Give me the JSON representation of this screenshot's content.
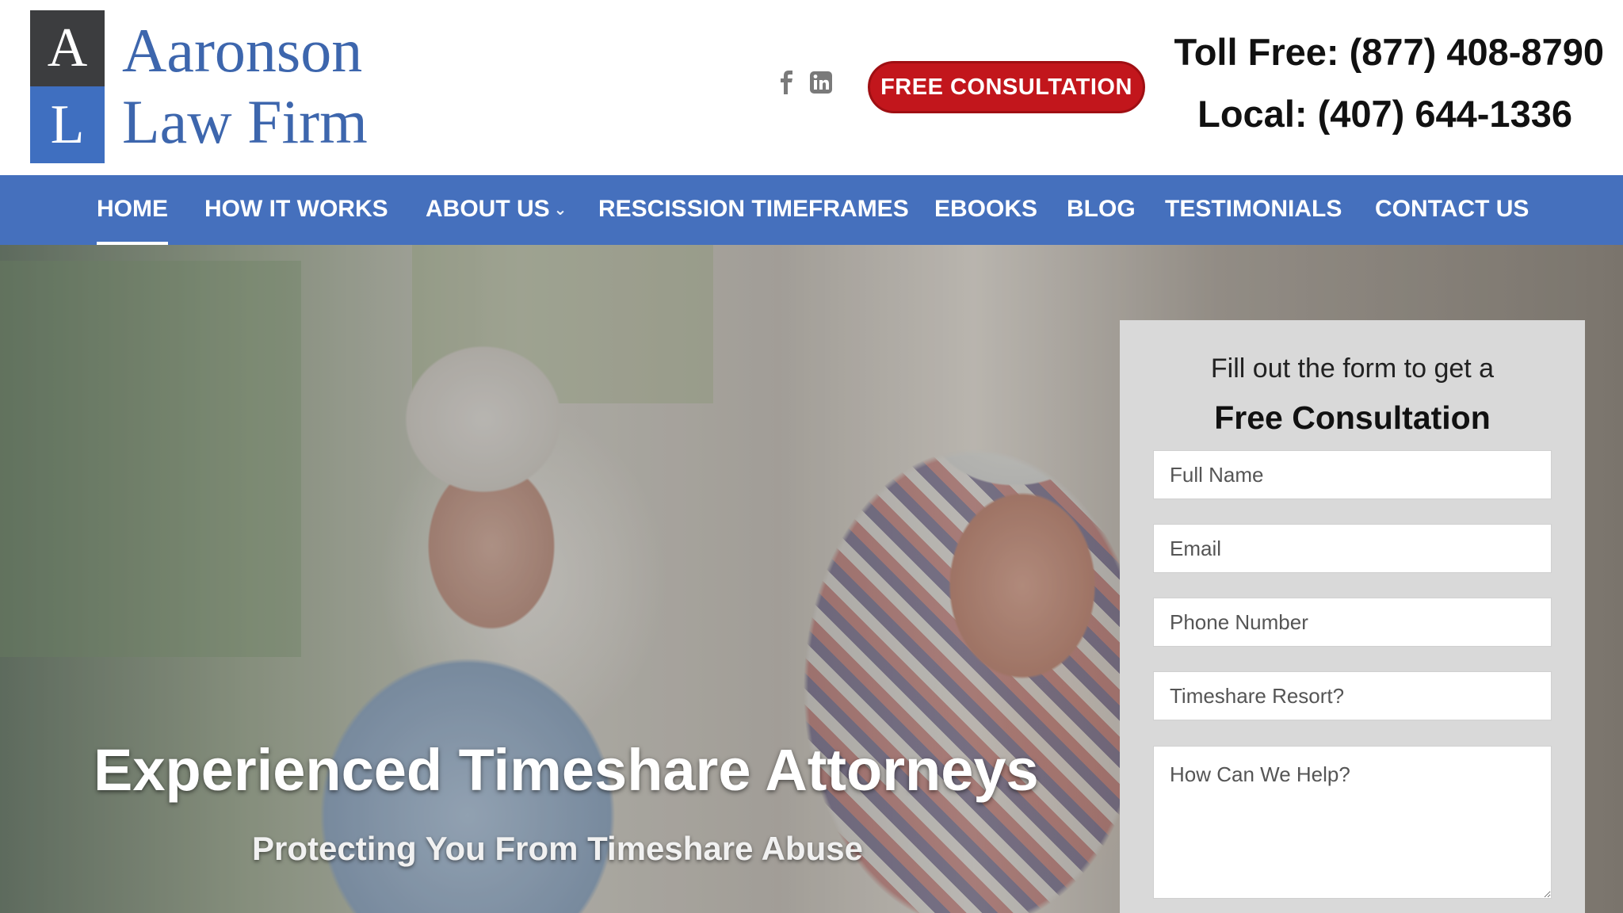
{
  "header": {
    "logo": {
      "letter_top": "A",
      "letter_bottom": "L",
      "name_line1": "Aaronson",
      "name_line2": "Law Firm"
    },
    "social": [
      {
        "icon": "facebook-icon"
      },
      {
        "icon": "linkedin-icon"
      }
    ],
    "cta_label": "FREE CONSULTATION",
    "phone_toll_free": "Toll Free: (877) 408-8790",
    "phone_local": "Local: (407) 644-1336"
  },
  "nav": {
    "items": [
      {
        "label": "HOME",
        "active": true
      },
      {
        "label": "HOW IT WORKS"
      },
      {
        "label": "ABOUT US",
        "dropdown": true
      },
      {
        "label": "RESCISSION TIMEFRAMES"
      },
      {
        "label": "EBOOKS"
      },
      {
        "label": "BLOG"
      },
      {
        "label": "TESTIMONIALS"
      },
      {
        "label": "CONTACT US"
      }
    ]
  },
  "hero": {
    "title": "Experienced Timeshare Attorneys",
    "subtitle": "Protecting You From Timeshare Abuse"
  },
  "form": {
    "intro": "Fill out the form to get a",
    "title": "Free Consultation",
    "fields": {
      "full_name": "Full Name",
      "email": "Email",
      "phone": "Phone Number",
      "resort": "Timeshare Resort?",
      "message": "How Can We Help?"
    }
  },
  "colors": {
    "nav_bg": "#4570bd",
    "cta_red": "#c2161c",
    "logo_blue": "#3d66ad",
    "logo_dark": "#3c3d3f",
    "form_bg": "#d9d9d9"
  }
}
